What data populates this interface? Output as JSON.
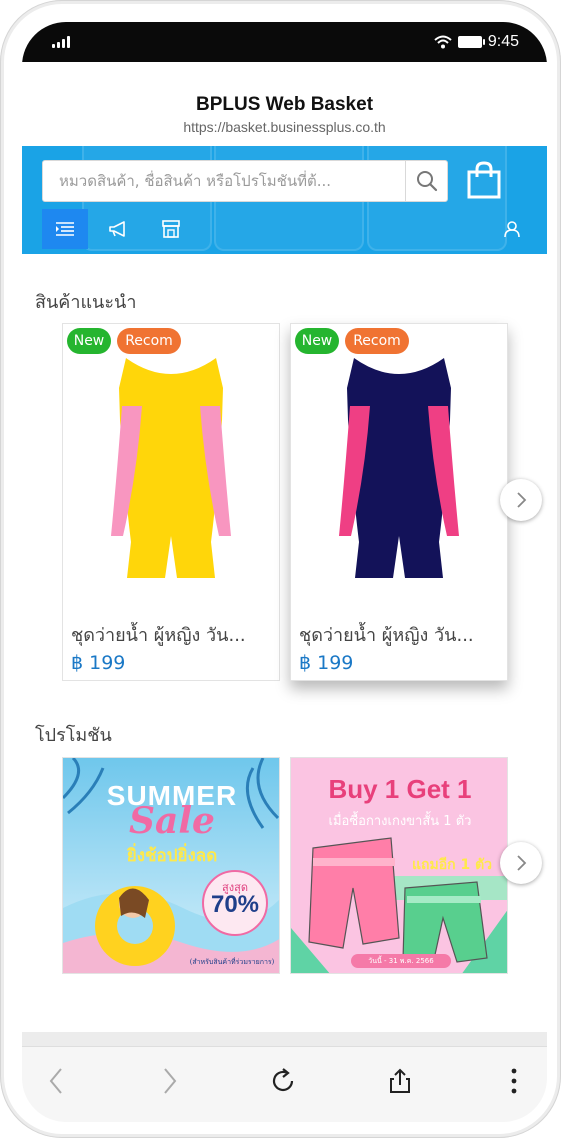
{
  "status_bar": {
    "time": "9:45"
  },
  "browser": {
    "title": "BPLUS Web Basket",
    "url": "https://basket.businessplus.co.th"
  },
  "search": {
    "placeholder": "หมวดสินค้า, ชื่อสินค้า หรือโปรโมชันที่ต้..."
  },
  "icons": {
    "search": "search-icon",
    "cart": "shopping-bag-icon",
    "categories": "category-list-icon",
    "promotions": "megaphone-icon",
    "store": "store-icon",
    "account": "user-icon",
    "next": "chevron-right-icon",
    "back": "back-icon",
    "forward": "forward-icon",
    "reload": "reload-icon",
    "share": "share-icon",
    "more": "more-vertical-icon"
  },
  "featured": {
    "title": "สินค้าแนะนำ",
    "products": [
      {
        "badge_new": "New",
        "badge_recom": "Recom",
        "name": "ชุดว่ายน้ำ ผู้หญิง วัน...",
        "price": "฿ 199",
        "body_color": "#ffd60a",
        "panel_color": "#f896c0"
      },
      {
        "badge_new": "New",
        "badge_recom": "Recom",
        "name": "ชุดว่ายน้ำ ผู้หญิง วัน...",
        "price": "฿ 199",
        "body_color": "#131259",
        "panel_color": "#ef3f84"
      }
    ]
  },
  "promotions": {
    "title": "โปรโมชัน",
    "items": [
      {
        "line1": "SUMMER",
        "line2": "Sale",
        "line3": "ยิ่งช้อปยิ่งลด",
        "discount_label": "สูงสุด",
        "discount": "70%",
        "footnote": "(สำหรับสินค้าที่ร่วมรายการ)"
      },
      {
        "line1": "Buy 1 Get 1",
        "line2": "เมื่อซื้อกางเกงขาสั้น 1 ตัว",
        "ribbon": "แถมอีก 1 ตัว",
        "footnote": "วันนี้ - 31 พ.ค. 2566"
      }
    ]
  },
  "colors": {
    "banner": "#1aa3e6",
    "badge_new": "#25b52f",
    "badge_recom": "#f07332",
    "price": "#1a78c6"
  }
}
